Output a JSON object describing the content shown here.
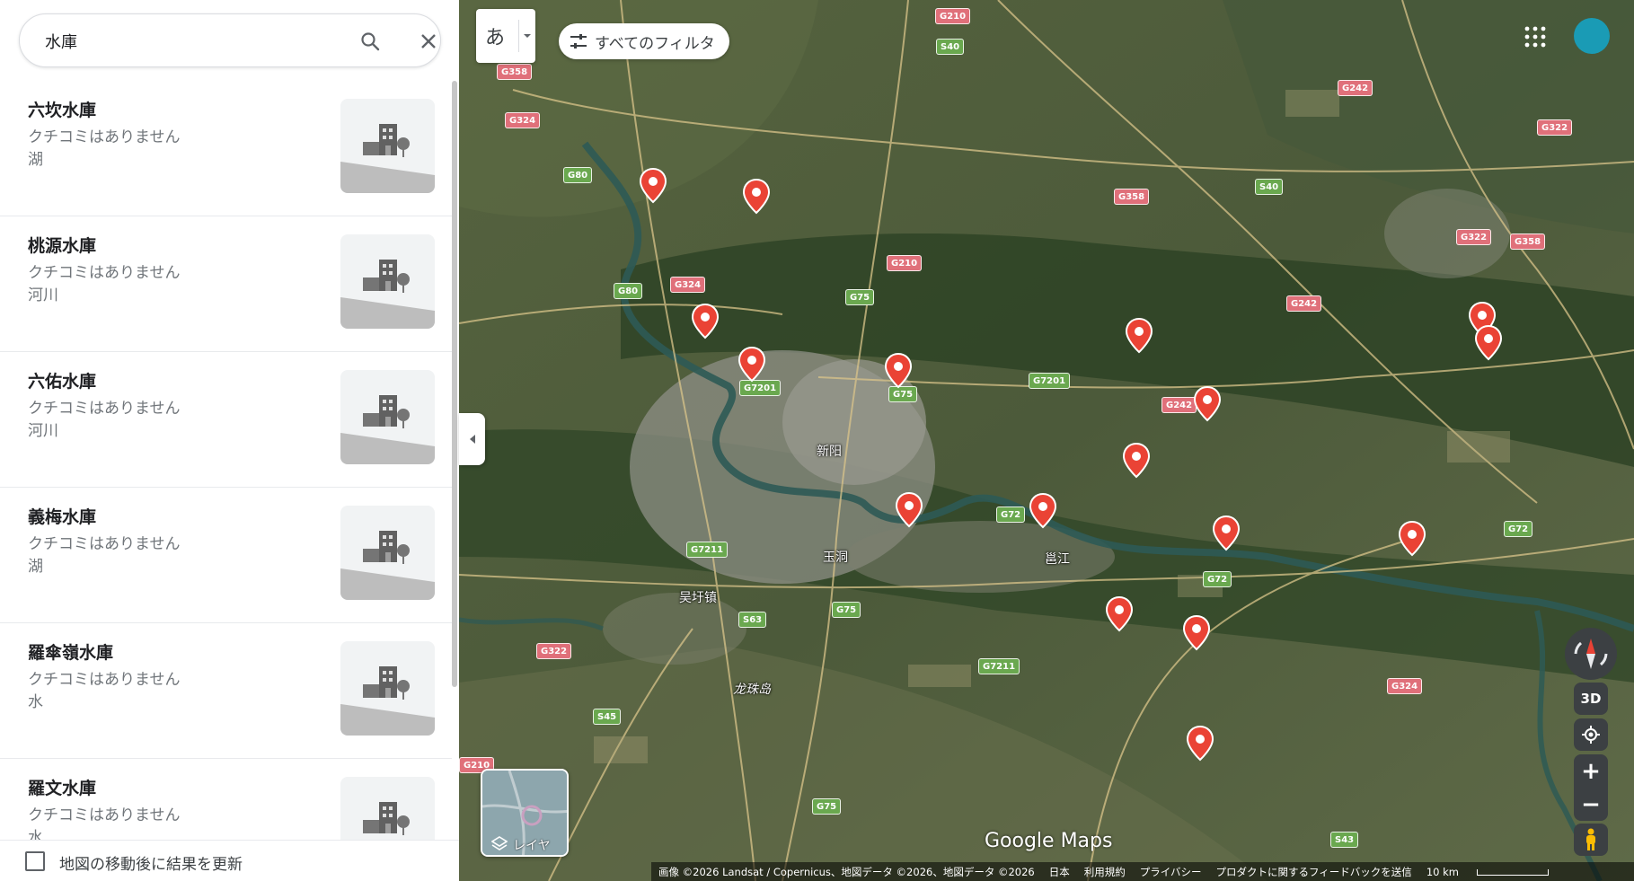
{
  "search": {
    "value": "水庫"
  },
  "results": [
    {
      "name": "六坎水庫",
      "reviews": "クチコミはありません",
      "category": "湖"
    },
    {
      "name": "桃源水庫",
      "reviews": "クチコミはありません",
      "category": "河川"
    },
    {
      "name": "六佑水庫",
      "reviews": "クチコミはありません",
      "category": "河川"
    },
    {
      "name": "義梅水庫",
      "reviews": "クチコミはありません",
      "category": "湖"
    },
    {
      "name": "羅傘嶺水庫",
      "reviews": "クチコミはありません",
      "category": "水"
    },
    {
      "name": "羅文水庫",
      "reviews": "クチコミはありません",
      "category": "水"
    }
  ],
  "footer": {
    "update_label": "地図の移動後に結果を更新",
    "update_checked": false
  },
  "map_ui": {
    "ime_char": "あ",
    "filter_label": "すべてのフィルタ",
    "layers_label": "レイヤ",
    "btn_3d": "3D",
    "zoom_in": "+",
    "zoom_out": "−",
    "logo": "Google Maps"
  },
  "attribution": {
    "imagery": "画像 ©2026 Landsat / Copernicus、地図データ ©2026、地図データ ©2026",
    "country": "日本",
    "terms": "利用規約",
    "privacy": "プライバシー",
    "feedback": "プロダクトに関するフィードバックを送信",
    "scale": "10 km"
  },
  "place_labels": [
    {
      "text": "新阳",
      "italic": false
    },
    {
      "text": "玉洞",
      "italic": false
    },
    {
      "text": "吴圩镇",
      "italic": false
    },
    {
      "text": "邕江",
      "italic": false
    },
    {
      "text": "龙珠岛",
      "italic": true
    }
  ],
  "road_shields": [
    "G210",
    "S40",
    "G358",
    "G324",
    "G80",
    "G242",
    "G322",
    "S40",
    "G358",
    "G322",
    "G358",
    "G210",
    "G324",
    "G80",
    "G75",
    "G242",
    "G7201",
    "G75",
    "G7201",
    "G242",
    "G72",
    "G7211",
    "S63",
    "G75",
    "G322",
    "G72",
    "G72",
    "G7211",
    "G324",
    "S45",
    "G210",
    "G75",
    "S43"
  ],
  "colors": {
    "pin_red": "#ea4335",
    "accent": "#1a73e8",
    "avatar": "#1a9bb5"
  }
}
